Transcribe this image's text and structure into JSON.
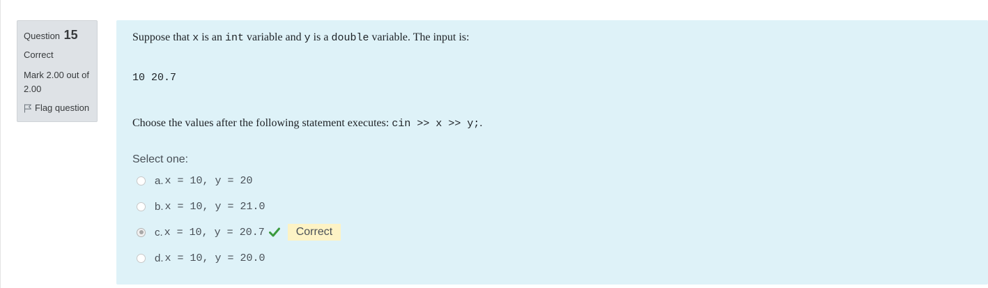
{
  "info": {
    "question_word": "Question",
    "question_number": "15",
    "state": "Correct",
    "grade": "Mark 2.00 out of 2.00",
    "flag_label": "Flag question"
  },
  "question": {
    "text_part1": "Suppose that ",
    "code_x": "x",
    "text_part2": " is an ",
    "code_int": "int",
    "text_part3": " variable and ",
    "code_y": "y",
    "text_part4": " is a ",
    "code_double": "double",
    "text_part5": " variable. The input is:",
    "input_value": "10 20.7",
    "choose_text": "Choose the values after the following statement executes: ",
    "statement_code": "cin >> x >> y;",
    "choose_suffix": ".",
    "prompt": "Select one:"
  },
  "options": [
    {
      "letter": "a.",
      "text": "x = 10, y = 20",
      "selected": false
    },
    {
      "letter": "b.",
      "text": "x = 10, y = 21.0",
      "selected": false
    },
    {
      "letter": "c.",
      "text": "x = 10, y = 20.7",
      "selected": true
    },
    {
      "letter": "d.",
      "text": "x = 10, y = 20.0",
      "selected": false
    }
  ],
  "feedback": {
    "label": "Correct",
    "check_icon": "check-icon",
    "check_color": "#3b9a3d",
    "badge_color": "#fdf3c5"
  },
  "colors": {
    "info_bg": "#dee2e6",
    "content_bg": "#def2f8"
  }
}
